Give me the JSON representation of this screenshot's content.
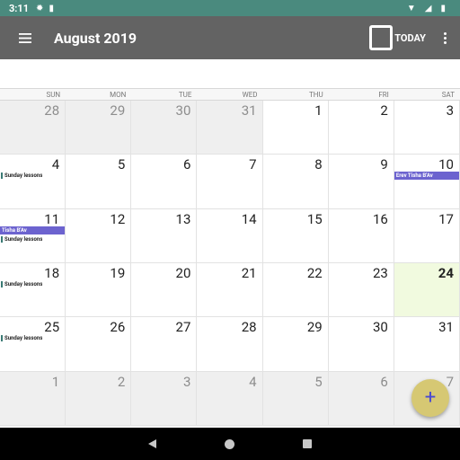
{
  "status_bar": {
    "time": "3:11"
  },
  "app_bar": {
    "title": "August 2019",
    "today_label": "TODAY"
  },
  "weekdays": [
    "SUN",
    "MON",
    "TUE",
    "WED",
    "THU",
    "FRI",
    "SAT"
  ],
  "weeks": [
    [
      {
        "day": "28",
        "other": true
      },
      {
        "day": "29",
        "other": true
      },
      {
        "day": "30",
        "other": true
      },
      {
        "day": "31",
        "other": true
      },
      {
        "day": "1"
      },
      {
        "day": "2"
      },
      {
        "day": "3"
      }
    ],
    [
      {
        "day": "4",
        "events": [
          {
            "type": "line",
            "text": "Sunday lessons"
          }
        ]
      },
      {
        "day": "5"
      },
      {
        "day": "6"
      },
      {
        "day": "7"
      },
      {
        "day": "8"
      },
      {
        "day": "9"
      },
      {
        "day": "10",
        "events": [
          {
            "type": "bar",
            "text": "Erev Tisha B'Av"
          }
        ]
      }
    ],
    [
      {
        "day": "11",
        "events": [
          {
            "type": "bar",
            "text": "Tisha B'Av"
          },
          {
            "type": "line",
            "text": "Sunday lessons"
          }
        ]
      },
      {
        "day": "12"
      },
      {
        "day": "13"
      },
      {
        "day": "14"
      },
      {
        "day": "15"
      },
      {
        "day": "16"
      },
      {
        "day": "17"
      }
    ],
    [
      {
        "day": "18",
        "events": [
          {
            "type": "line",
            "text": "Sunday lessons"
          }
        ]
      },
      {
        "day": "19"
      },
      {
        "day": "20"
      },
      {
        "day": "21"
      },
      {
        "day": "22"
      },
      {
        "day": "23"
      },
      {
        "day": "24",
        "today": true
      }
    ],
    [
      {
        "day": "25",
        "events": [
          {
            "type": "line",
            "text": "Sunday lessons"
          }
        ]
      },
      {
        "day": "26"
      },
      {
        "day": "27"
      },
      {
        "day": "28"
      },
      {
        "day": "29"
      },
      {
        "day": "30"
      },
      {
        "day": "31"
      }
    ],
    [
      {
        "day": "1",
        "other": true
      },
      {
        "day": "2",
        "other": true
      },
      {
        "day": "3",
        "other": true
      },
      {
        "day": "4",
        "other": true
      },
      {
        "day": "5",
        "other": true
      },
      {
        "day": "6",
        "other": true
      },
      {
        "day": "7",
        "other": true
      }
    ]
  ],
  "fab": {
    "icon": "+"
  },
  "colors": {
    "status_bar": "#4a8a7e",
    "app_bar": "#636363",
    "event_bar": "#6c63cf",
    "today_cell": "#f1fadf",
    "fab": "#d6c873"
  }
}
